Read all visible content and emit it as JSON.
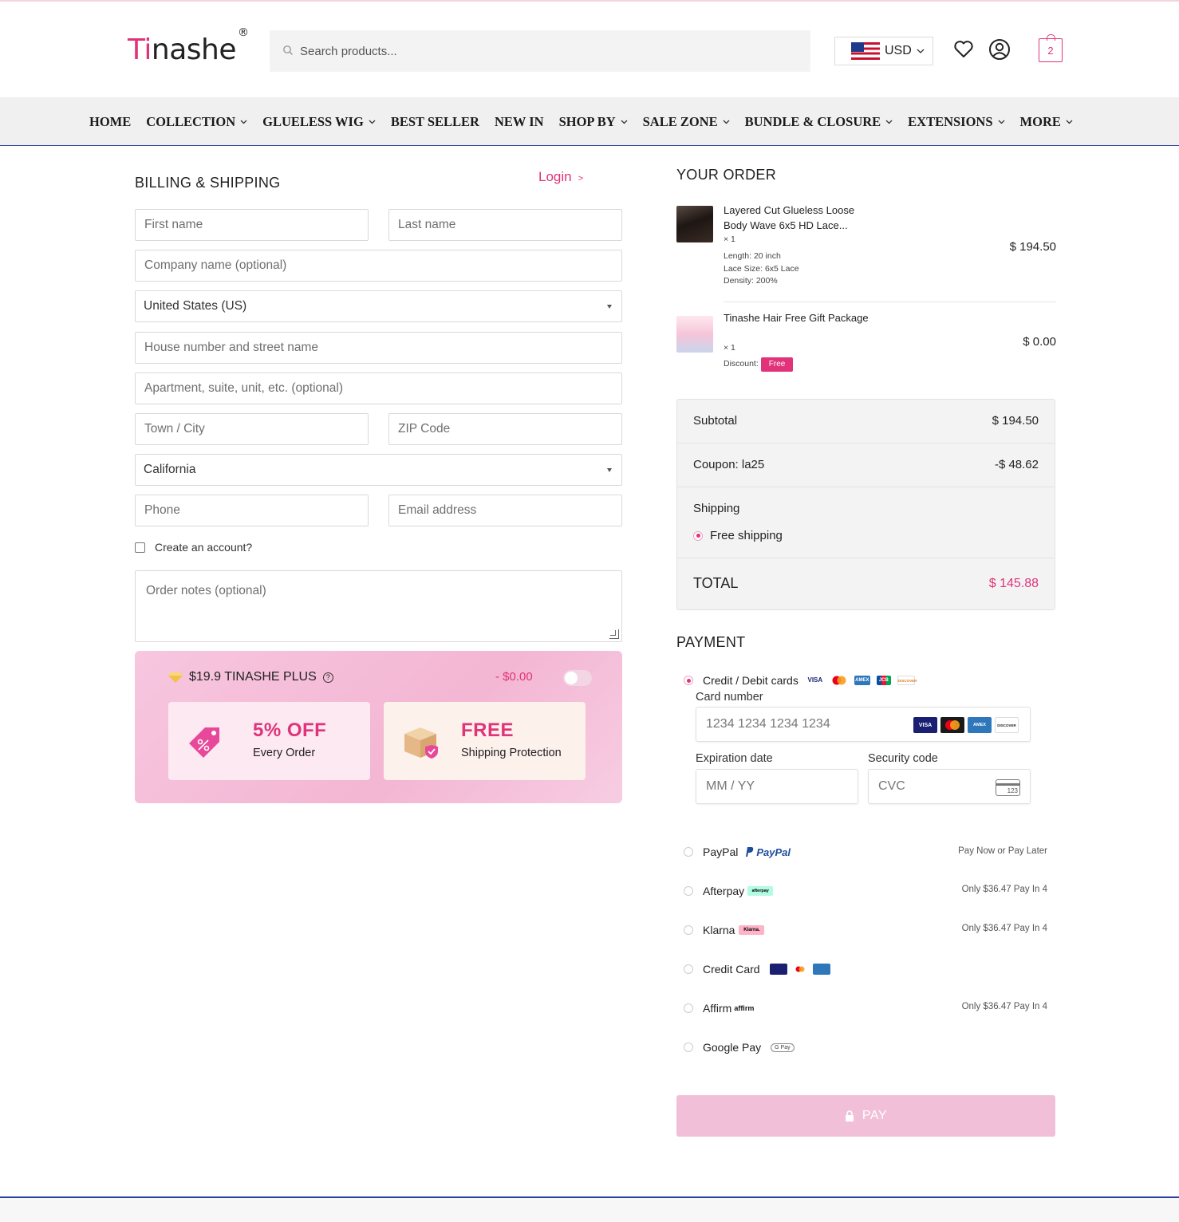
{
  "header": {
    "logo_prefix": "Ti",
    "logo_rest": "nashe",
    "logo_mark": "®",
    "search_placeholder": "Search products...",
    "currency": "USD",
    "cart_count": "2",
    "icons": [
      "search-icon",
      "us-flag-icon",
      "wishlist-heart-icon",
      "account-icon",
      "cart-icon"
    ]
  },
  "nav": {
    "items": [
      {
        "label": "HOME",
        "has_dropdown": false
      },
      {
        "label": "COLLECTION",
        "has_dropdown": true
      },
      {
        "label": "GLUELESS WIG",
        "has_dropdown": true
      },
      {
        "label": "BEST SELLER",
        "has_dropdown": false
      },
      {
        "label": "NEW IN",
        "has_dropdown": false
      },
      {
        "label": "SHOP BY",
        "has_dropdown": true
      },
      {
        "label": "SALE ZONE",
        "has_dropdown": true
      },
      {
        "label": "BUNDLE & CLOSURE",
        "has_dropdown": true
      },
      {
        "label": "EXTENSIONS",
        "has_dropdown": true
      },
      {
        "label": "MORE",
        "has_dropdown": true
      }
    ]
  },
  "billing": {
    "title": "BILLING & SHIPPING",
    "login_label": "Login",
    "login_arrow": ">",
    "first_name_placeholder": "First name",
    "last_name_placeholder": "Last name",
    "company_placeholder": "Company name (optional)",
    "country_value": "United States (US)",
    "street_placeholder": "House number and street name",
    "apartment_placeholder": "Apartment, suite, unit, etc. (optional)",
    "city_placeholder": "Town / City",
    "zip_placeholder": "ZIP Code",
    "state_value": "California",
    "phone_placeholder": "Phone",
    "email_placeholder": "Email address",
    "create_account_label": "Create an account?",
    "create_account_checked": false,
    "notes_placeholder": "Order notes (optional)"
  },
  "plus": {
    "title": "$19.9 TINASHE PLUS",
    "help_glyph": "?",
    "price": "- $0.00",
    "toggle_on": false,
    "benefits": [
      {
        "headline": "5% OFF",
        "subtext": "Every Order"
      },
      {
        "headline": "FREE",
        "subtext": "Shipping Protection"
      }
    ]
  },
  "order": {
    "title": "YOUR ORDER",
    "items": [
      {
        "name": "Layered Cut Glueless Loose Body Wave 6x5 HD Lace...",
        "qty": "× 1",
        "meta": [
          "Length: 20 inch",
          "Lace Size: 6x5 Lace",
          "Density: 200%"
        ],
        "price": "$ 194.50"
      },
      {
        "name": "Tinashe Hair Free Gift Package",
        "qty": "× 1",
        "discount_label": "Discount:",
        "discount_tag": "Free",
        "price": "$ 0.00"
      }
    ],
    "subtotal_label": "Subtotal",
    "subtotal_value": "$ 194.50",
    "coupon_label": "Coupon: la25",
    "coupon_value": "-$ 48.62",
    "shipping_label": "Shipping",
    "shipping_option": "Free shipping",
    "total_label": "TOTAL",
    "total_value": "$ 145.88",
    "accent_color": "#e0337a"
  },
  "payment": {
    "title": "PAYMENT",
    "card_option_label": "Credit / Debit cards",
    "card_number_label": "Card number",
    "card_number_placeholder": "1234 1234 1234 1234",
    "expiry_label": "Expiration date",
    "expiry_placeholder": "MM / YY",
    "cvc_label": "Security code",
    "cvc_placeholder": "CVC",
    "cvc_icon_text": "123",
    "brands": [
      "VISA",
      "mastercard",
      "AMEX",
      "DISCOVER"
    ],
    "card_strip_brands": [
      "VISA",
      "mastercard",
      "AMEX",
      "JCB",
      "DISCOVER"
    ],
    "options": [
      {
        "label": "PayPal",
        "badge": "PayPal",
        "note": "Pay Now or Pay Later"
      },
      {
        "label": "Afterpay",
        "badge": "afterpay",
        "note": "Only $36.47 Pay In 4"
      },
      {
        "label": "Klarna",
        "badge": "Klarna.",
        "note": "Only $36.47 Pay In 4"
      },
      {
        "label": "Credit Card",
        "badge": "",
        "note": ""
      },
      {
        "label": "Affirm",
        "badge": "affirm",
        "note": "Only $36.47 Pay In 4"
      },
      {
        "label": "Google Pay",
        "badge": "G Pay",
        "note": ""
      }
    ],
    "pay_button": "PAY"
  }
}
